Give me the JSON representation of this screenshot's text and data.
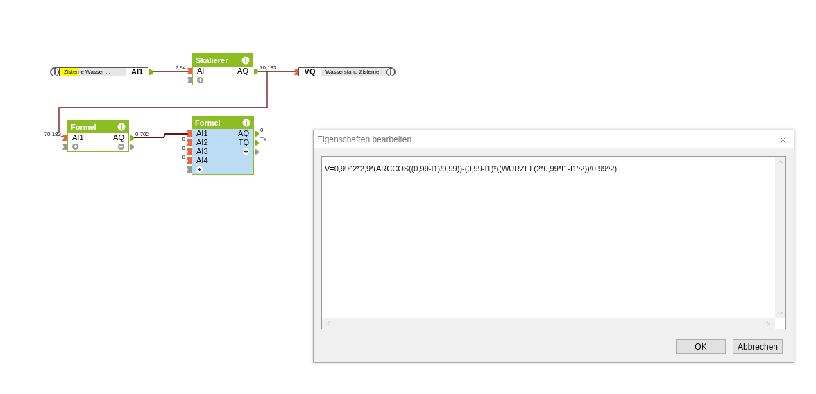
{
  "canvas": {
    "input_node": {
      "label": "Zisterne  Wasser ...",
      "channel": "AI1"
    },
    "output_node": {
      "channel": "VQ",
      "label": "Wasserstand Zisterne"
    },
    "blocks": [
      {
        "title": "Skalierer",
        "selected": false,
        "add_output": false,
        "inputs": [
          {
            "label": "AI",
            "value": "2,94"
          }
        ],
        "outputs": [
          {
            "label": "AQ",
            "value": "70,183"
          }
        ]
      },
      {
        "title": "Formel",
        "selected": false,
        "add_output": true,
        "inputs": [
          {
            "label": "AI1",
            "value": "70,183"
          }
        ],
        "outputs": [
          {
            "label": "AQ",
            "value": "0,702"
          }
        ]
      },
      {
        "title": "Formel",
        "selected": true,
        "add_output": true,
        "inputs": [
          {
            "label": "AI1"
          },
          {
            "label": "AI2",
            "value": "0"
          },
          {
            "label": "AI3",
            "value": "0"
          },
          {
            "label": "AI4",
            "value": "0"
          }
        ],
        "outputs": [
          {
            "label": "AQ",
            "value": "0"
          },
          {
            "label": "TQ",
            "value": "Tx"
          }
        ]
      }
    ]
  },
  "dialog": {
    "title": "Eigenschaften bearbeiten",
    "formula": "V=0,99^2*2,9*(ARCCOS((0,99-I1)/0,99))-(0,99-I1)*((WURZEL(2*0,99*I1-I1^2))/0,99^2)",
    "buttons": [
      "OK",
      "Abbrechen"
    ]
  }
}
